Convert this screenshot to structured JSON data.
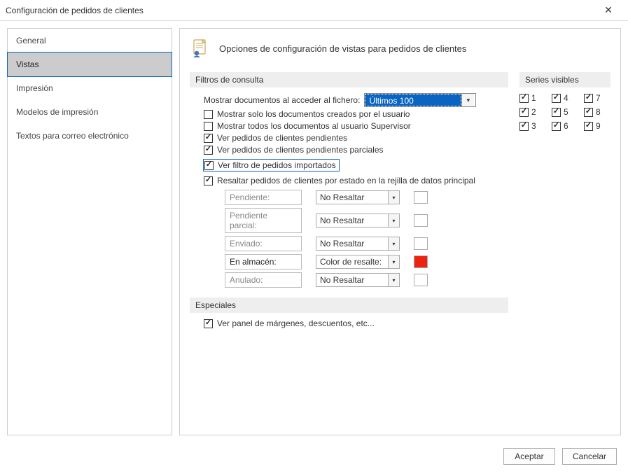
{
  "window": {
    "title": "Configuración de pedidos de clientes"
  },
  "sidebar": {
    "items": [
      {
        "label": "General"
      },
      {
        "label": "Vistas"
      },
      {
        "label": "Impresión"
      },
      {
        "label": "Modelos de impresión"
      },
      {
        "label": "Textos para correo electrónico"
      }
    ],
    "active_index": 1
  },
  "header": {
    "title": "Opciones de configuración de vistas para pedidos de clientes"
  },
  "sections": {
    "filters_title": "Filtros de consulta",
    "series_title": "Series visibles",
    "specials_title": "Especiales"
  },
  "filters": {
    "doc_access_label": "Mostrar documentos al acceder al fichero:",
    "doc_access_value": "Últimos 100",
    "checks": [
      {
        "label": "Mostrar solo los documentos creados por el usuario",
        "checked": false
      },
      {
        "label": "Mostrar todos los documentos al usuario Supervisor",
        "checked": false
      },
      {
        "label": "Ver pedidos de clientes pendientes",
        "checked": true
      },
      {
        "label": "Ver pedidos de clientes pendientes parciales",
        "checked": true
      },
      {
        "label": "Ver filtro de pedidos importados",
        "checked": true,
        "highlighted": true
      },
      {
        "label": "Resaltar pedidos de clientes por estado en la rejilla de datos principal",
        "checked": true
      }
    ],
    "states": [
      {
        "label": "Pendiente:",
        "option": "No Resaltar",
        "swatch": "white",
        "active": false
      },
      {
        "label": "Pendiente parcial:",
        "option": "No Resaltar",
        "swatch": "white",
        "active": false
      },
      {
        "label": "Enviado:",
        "option": "No Resaltar",
        "swatch": "white",
        "active": false
      },
      {
        "label": "En almacén:",
        "option": "Color de resalte:",
        "swatch": "red",
        "active": true
      },
      {
        "label": "Anulado:",
        "option": "No Resaltar",
        "swatch": "white",
        "active": false
      }
    ]
  },
  "series": {
    "items": [
      "1",
      "4",
      "7",
      "2",
      "5",
      "8",
      "3",
      "6",
      "9"
    ]
  },
  "specials": {
    "margins_label": "Ver panel de márgenes, descuentos, etc...",
    "margins_checked": true
  },
  "footer": {
    "accept": "Aceptar",
    "cancel": "Cancelar"
  }
}
